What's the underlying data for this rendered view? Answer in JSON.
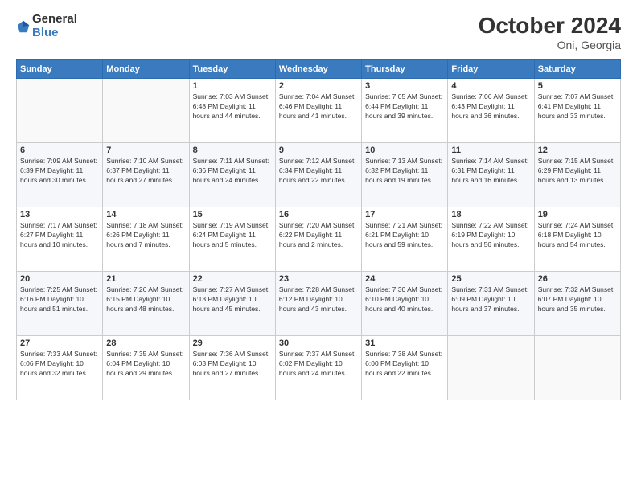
{
  "logo": {
    "general": "General",
    "blue": "Blue"
  },
  "title": "October 2024",
  "location": "Oni, Georgia",
  "days_header": [
    "Sunday",
    "Monday",
    "Tuesday",
    "Wednesday",
    "Thursday",
    "Friday",
    "Saturday"
  ],
  "weeks": [
    [
      {
        "num": "",
        "info": ""
      },
      {
        "num": "",
        "info": ""
      },
      {
        "num": "1",
        "info": "Sunrise: 7:03 AM\nSunset: 6:48 PM\nDaylight: 11 hours and 44 minutes."
      },
      {
        "num": "2",
        "info": "Sunrise: 7:04 AM\nSunset: 6:46 PM\nDaylight: 11 hours and 41 minutes."
      },
      {
        "num": "3",
        "info": "Sunrise: 7:05 AM\nSunset: 6:44 PM\nDaylight: 11 hours and 39 minutes."
      },
      {
        "num": "4",
        "info": "Sunrise: 7:06 AM\nSunset: 6:43 PM\nDaylight: 11 hours and 36 minutes."
      },
      {
        "num": "5",
        "info": "Sunrise: 7:07 AM\nSunset: 6:41 PM\nDaylight: 11 hours and 33 minutes."
      }
    ],
    [
      {
        "num": "6",
        "info": "Sunrise: 7:09 AM\nSunset: 6:39 PM\nDaylight: 11 hours and 30 minutes."
      },
      {
        "num": "7",
        "info": "Sunrise: 7:10 AM\nSunset: 6:37 PM\nDaylight: 11 hours and 27 minutes."
      },
      {
        "num": "8",
        "info": "Sunrise: 7:11 AM\nSunset: 6:36 PM\nDaylight: 11 hours and 24 minutes."
      },
      {
        "num": "9",
        "info": "Sunrise: 7:12 AM\nSunset: 6:34 PM\nDaylight: 11 hours and 22 minutes."
      },
      {
        "num": "10",
        "info": "Sunrise: 7:13 AM\nSunset: 6:32 PM\nDaylight: 11 hours and 19 minutes."
      },
      {
        "num": "11",
        "info": "Sunrise: 7:14 AM\nSunset: 6:31 PM\nDaylight: 11 hours and 16 minutes."
      },
      {
        "num": "12",
        "info": "Sunrise: 7:15 AM\nSunset: 6:29 PM\nDaylight: 11 hours and 13 minutes."
      }
    ],
    [
      {
        "num": "13",
        "info": "Sunrise: 7:17 AM\nSunset: 6:27 PM\nDaylight: 11 hours and 10 minutes."
      },
      {
        "num": "14",
        "info": "Sunrise: 7:18 AM\nSunset: 6:26 PM\nDaylight: 11 hours and 7 minutes."
      },
      {
        "num": "15",
        "info": "Sunrise: 7:19 AM\nSunset: 6:24 PM\nDaylight: 11 hours and 5 minutes."
      },
      {
        "num": "16",
        "info": "Sunrise: 7:20 AM\nSunset: 6:22 PM\nDaylight: 11 hours and 2 minutes."
      },
      {
        "num": "17",
        "info": "Sunrise: 7:21 AM\nSunset: 6:21 PM\nDaylight: 10 hours and 59 minutes."
      },
      {
        "num": "18",
        "info": "Sunrise: 7:22 AM\nSunset: 6:19 PM\nDaylight: 10 hours and 56 minutes."
      },
      {
        "num": "19",
        "info": "Sunrise: 7:24 AM\nSunset: 6:18 PM\nDaylight: 10 hours and 54 minutes."
      }
    ],
    [
      {
        "num": "20",
        "info": "Sunrise: 7:25 AM\nSunset: 6:16 PM\nDaylight: 10 hours and 51 minutes."
      },
      {
        "num": "21",
        "info": "Sunrise: 7:26 AM\nSunset: 6:15 PM\nDaylight: 10 hours and 48 minutes."
      },
      {
        "num": "22",
        "info": "Sunrise: 7:27 AM\nSunset: 6:13 PM\nDaylight: 10 hours and 45 minutes."
      },
      {
        "num": "23",
        "info": "Sunrise: 7:28 AM\nSunset: 6:12 PM\nDaylight: 10 hours and 43 minutes."
      },
      {
        "num": "24",
        "info": "Sunrise: 7:30 AM\nSunset: 6:10 PM\nDaylight: 10 hours and 40 minutes."
      },
      {
        "num": "25",
        "info": "Sunrise: 7:31 AM\nSunset: 6:09 PM\nDaylight: 10 hours and 37 minutes."
      },
      {
        "num": "26",
        "info": "Sunrise: 7:32 AM\nSunset: 6:07 PM\nDaylight: 10 hours and 35 minutes."
      }
    ],
    [
      {
        "num": "27",
        "info": "Sunrise: 7:33 AM\nSunset: 6:06 PM\nDaylight: 10 hours and 32 minutes."
      },
      {
        "num": "28",
        "info": "Sunrise: 7:35 AM\nSunset: 6:04 PM\nDaylight: 10 hours and 29 minutes."
      },
      {
        "num": "29",
        "info": "Sunrise: 7:36 AM\nSunset: 6:03 PM\nDaylight: 10 hours and 27 minutes."
      },
      {
        "num": "30",
        "info": "Sunrise: 7:37 AM\nSunset: 6:02 PM\nDaylight: 10 hours and 24 minutes."
      },
      {
        "num": "31",
        "info": "Sunrise: 7:38 AM\nSunset: 6:00 PM\nDaylight: 10 hours and 22 minutes."
      },
      {
        "num": "",
        "info": ""
      },
      {
        "num": "",
        "info": ""
      }
    ]
  ]
}
